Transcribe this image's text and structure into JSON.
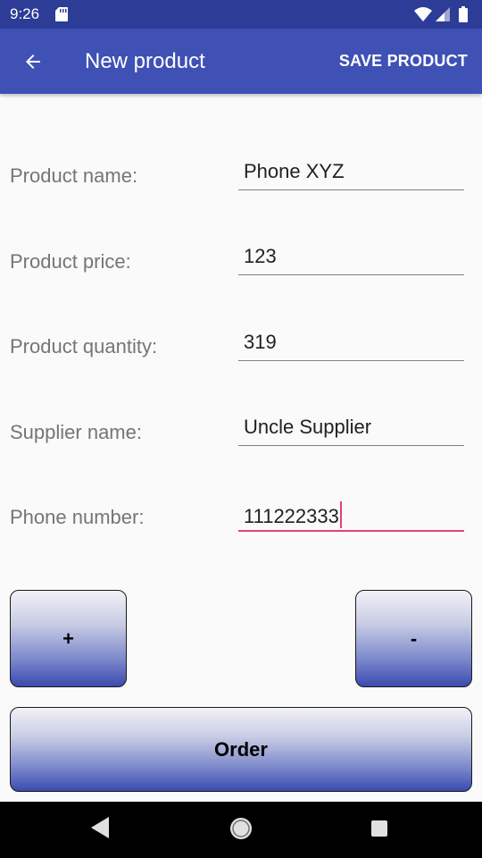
{
  "status_bar": {
    "time": "9:26",
    "icons": [
      "sd-card-icon",
      "wifi-icon",
      "signal-icon",
      "battery-icon"
    ]
  },
  "app_bar": {
    "back_icon": "arrow-left-icon",
    "title": "New product",
    "save_label": "SAVE PRODUCT",
    "color": "#3f51b5"
  },
  "form": {
    "product_name": {
      "label": "Product name:",
      "value": "Phone XYZ"
    },
    "product_price": {
      "label": "Product price:",
      "value": "123"
    },
    "product_quantity": {
      "label": "Product quantity:",
      "value": "319"
    },
    "supplier_name": {
      "label": "Supplier name:",
      "value": "Uncle Supplier"
    },
    "phone_number": {
      "label": "Phone number:",
      "value": "111222333",
      "focused": true
    }
  },
  "buttons": {
    "increment_label": "+",
    "decrement_label": "-",
    "order_label": "Order"
  },
  "nav_bar": {
    "icons": [
      "back-triangle-icon",
      "home-circle-icon",
      "recents-square-icon"
    ]
  },
  "colors": {
    "accent": "#e5407a",
    "primary_dark": "#2c3c97"
  }
}
